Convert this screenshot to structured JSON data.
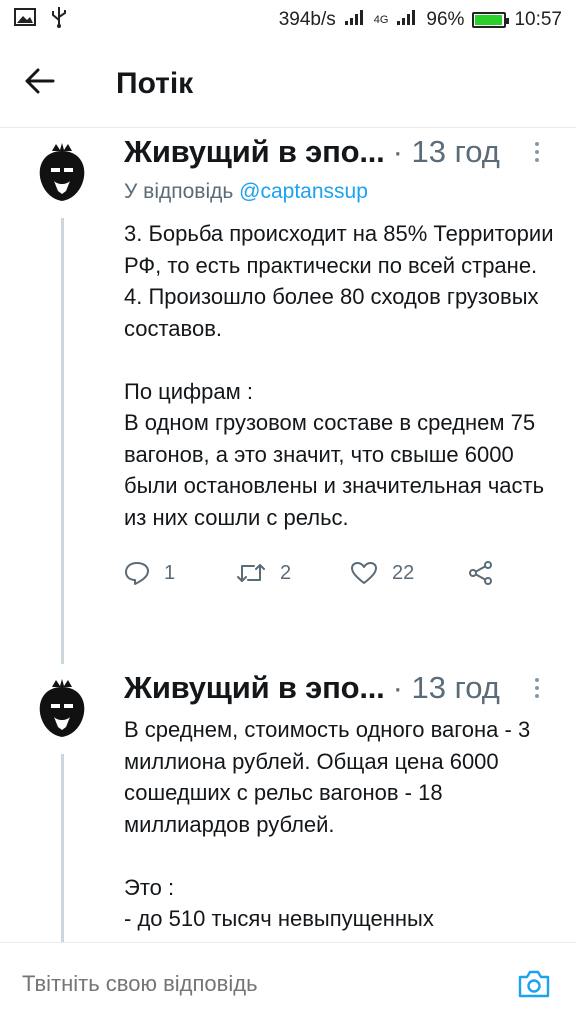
{
  "status_bar": {
    "net_speed": "394b/s",
    "network": "4G",
    "battery": "96%",
    "battery_level": 0.96,
    "time": "10:57"
  },
  "header": {
    "title": "Потік",
    "back_icon": "arrow-left-icon"
  },
  "tweets": [
    {
      "author": "Живущий в эпо...",
      "time": "· 13 год",
      "reply_prefix": "У відповідь",
      "reply_handle": "@captanssup",
      "text": "3. Борьба происходит на 85% Территории РФ, то есть практически по всей стране.\n4. Произошло более 80 сходов грузовых составов.\n\nПо цифрам :\nВ одном грузовом составе в среднем 75 вагонов, а это значит, что свыше 6000 были остановлены и значительная часть из них сошли с рельс.",
      "replies": "1",
      "retweets": "2",
      "likes": "22"
    },
    {
      "author": "Живущий в эпо...",
      "time": "· 13 год",
      "text": "В среднем, стоимость одного вагона - 3 миллиона рублей. Общая цена 6000 сошедших с рельс вагонов - 18 миллиардов рублей.\n\nЭто :\n- до 510 тысяч невыпущенных"
    }
  ],
  "reply_bar": {
    "placeholder": "Твітніть свою відповідь",
    "camera_icon": "camera-icon"
  },
  "colors": {
    "accent": "#1da1f2",
    "secondary_text": "#5b6b78",
    "thread_line": "#ccd6dd"
  }
}
